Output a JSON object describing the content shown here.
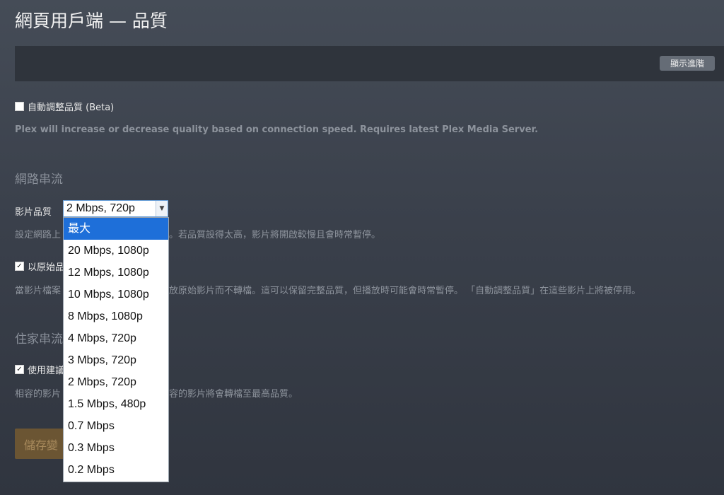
{
  "header": {
    "title": "網頁用戶端 — 品質"
  },
  "toolbar": {
    "advanced_button": "顯示進階"
  },
  "auto_quality": {
    "label": "自動調整品質 (Beta)",
    "checked": false,
    "description": "Plex will increase or decrease quality based on connection speed. Requires latest Plex Media Server."
  },
  "remote": {
    "section_title": "網路串流",
    "video_quality_label": "影片品質",
    "selected_value": "2 Mbps, 720p",
    "options": [
      "最大",
      "20 Mbps, 1080p",
      "12 Mbps, 1080p",
      "10 Mbps, 1080p",
      "8 Mbps, 1080p",
      "4 Mbps, 720p",
      "3 Mbps, 720p",
      "2 Mbps, 720p",
      "1.5 Mbps, 480p",
      "0.7 Mbps",
      "0.3 Mbps",
      "0.2 Mbps"
    ],
    "highlighted_option": "最大",
    "quality_desc_left": "設定網路上",
    "quality_desc_right": "。若品質設得太高，影片將開啟較慢且會時常暫停。",
    "original_label": "以原始品",
    "original_checked": true,
    "original_desc_left": "當影片檔案",
    "original_desc_right": "放原始影片而不轉檔。這可以保留完整品質，但播放時可能會時常暫停。 「自動調整品質」在這些影片上將被停用。"
  },
  "local": {
    "section_title": "住家串流",
    "recommend_label": "使用建議",
    "recommend_checked": true,
    "desc_left": "相容的影片",
    "desc_right": "容的影片將會轉檔至最高品質。"
  },
  "footer": {
    "save_button": "儲存變"
  }
}
